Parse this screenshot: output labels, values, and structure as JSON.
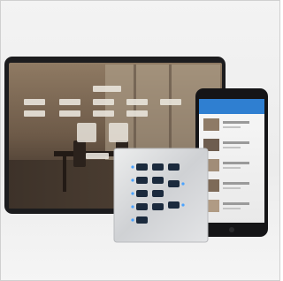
{
  "scene": {
    "description_free": true,
    "colors": {
      "background": "#efefef",
      "tablet_bezel": "#1c1c1e",
      "phone_bezel": "#151517",
      "phone_header": "#2f7fd1",
      "keypad_plate": "#d9dadd",
      "keypad_buttons": "#1b2a3d",
      "keypad_leds": "#4aa3ff"
    }
  },
  "tablet": {
    "room_buttons": [
      "",
      "",
      "",
      "",
      "",
      "",
      "",
      "",
      "",
      "",
      "",
      "",
      "",
      ""
    ]
  },
  "phone": {
    "list_items": [
      "",
      "",
      "",
      "",
      ""
    ]
  },
  "keypad": {
    "rows": 4,
    "columns": 3
  }
}
